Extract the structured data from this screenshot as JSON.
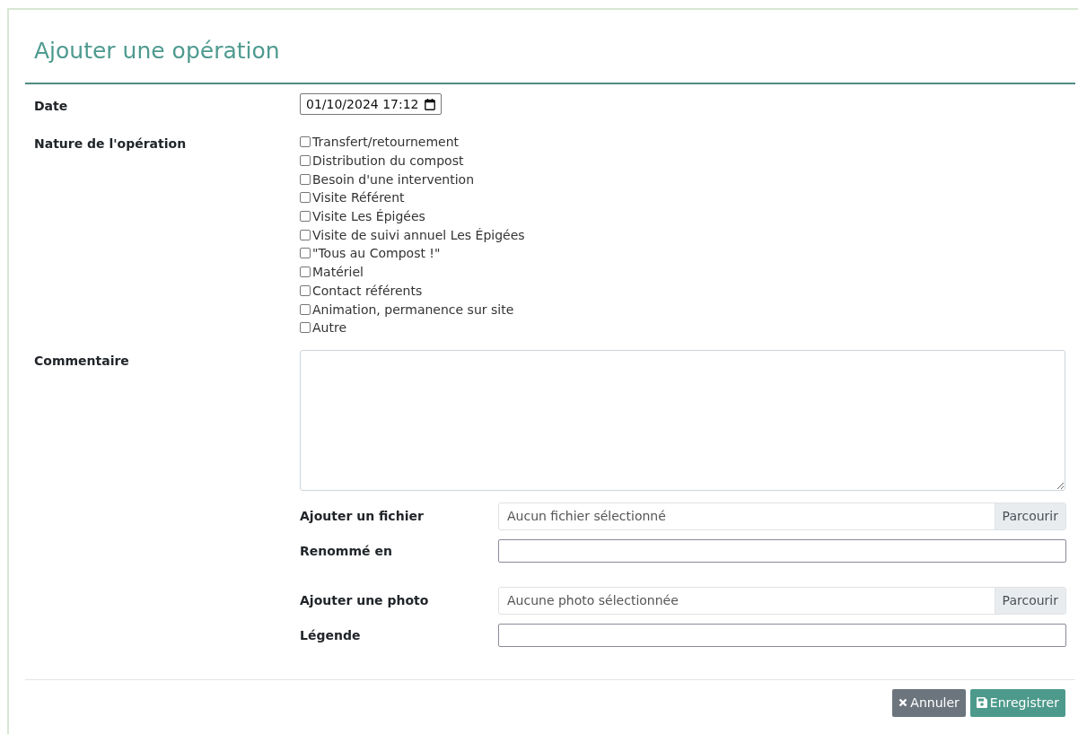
{
  "title": "Ajouter une opération",
  "date": {
    "label": "Date",
    "value": "01/10/2024  17:12"
  },
  "nature": {
    "label": "Nature de l'opération",
    "options": [
      {
        "label": "Transfert/retournement",
        "checked": false
      },
      {
        "label": "Distribution du compost",
        "checked": false
      },
      {
        "label": "Besoin d'une intervention",
        "checked": false
      },
      {
        "label": "Visite Référent",
        "checked": false
      },
      {
        "label": "Visite Les Épigées",
        "checked": false
      },
      {
        "label": "Visite de suivi annuel Les Épigées",
        "checked": false
      },
      {
        "label": "\"Tous au Compost !\"",
        "checked": false
      },
      {
        "label": "Matériel",
        "checked": false
      },
      {
        "label": "Contact référents",
        "checked": false
      },
      {
        "label": "Animation, permanence sur site",
        "checked": false
      },
      {
        "label": "Autre",
        "checked": false
      }
    ]
  },
  "comment": {
    "label": "Commentaire"
  },
  "attachments": [
    {
      "kind": "file",
      "label": "Ajouter un fichier",
      "placeholder": "Aucun fichier sélectionné",
      "button": "Parcourir"
    },
    {
      "kind": "text",
      "label": "Renommé en"
    },
    {
      "kind": "file",
      "label": "Ajouter une photo",
      "placeholder": "Aucune photo sélectionnée",
      "button": "Parcourir"
    },
    {
      "kind": "text",
      "label": "Légende"
    }
  ],
  "buttons": [
    {
      "kind": "cancel",
      "label": "Annuler"
    },
    {
      "kind": "save",
      "label": "Enregistrer"
    }
  ]
}
